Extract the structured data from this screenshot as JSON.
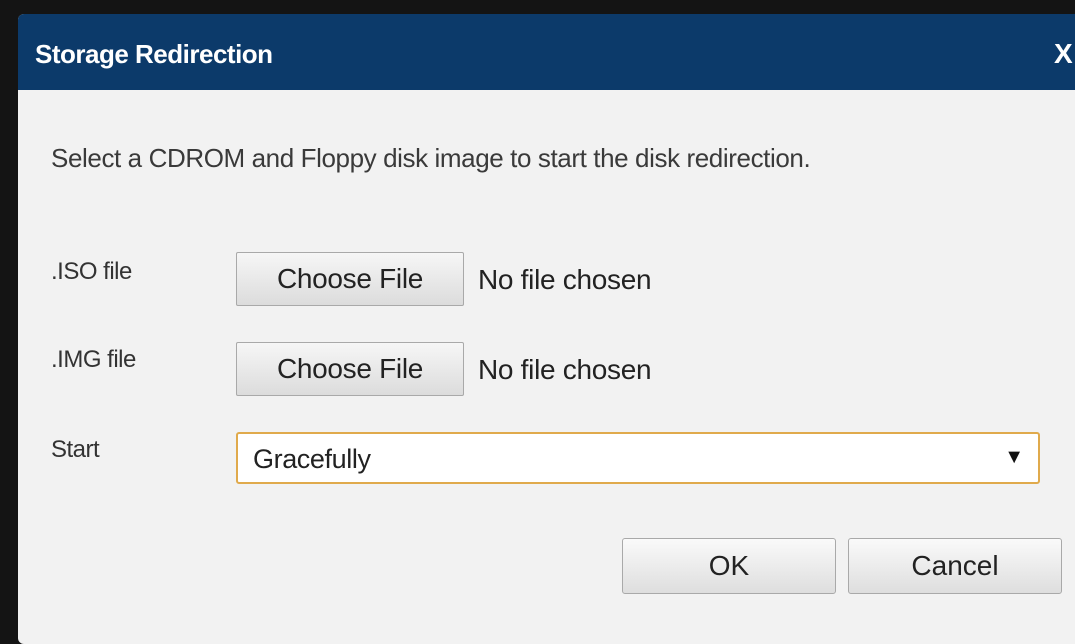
{
  "dialog": {
    "title": "Storage Redirection",
    "close_label": "X",
    "instructions": "Select a CDROM and Floppy disk image to start the disk redirection."
  },
  "fields": {
    "iso": {
      "label": ".ISO file",
      "button_label": "Choose File",
      "status": "No file chosen"
    },
    "img": {
      "label": ".IMG file",
      "button_label": "Choose File",
      "status": "No file chosen"
    },
    "start": {
      "label": "Start",
      "selected": "Gracefully"
    }
  },
  "buttons": {
    "ok_label": "OK",
    "cancel_label": "Cancel"
  },
  "colors": {
    "titlebar": "#0c3a6a",
    "select_focus_border": "#e0aa4c"
  },
  "icons": {
    "close": "close-icon",
    "dropdown": "dropdown-arrow-icon"
  }
}
